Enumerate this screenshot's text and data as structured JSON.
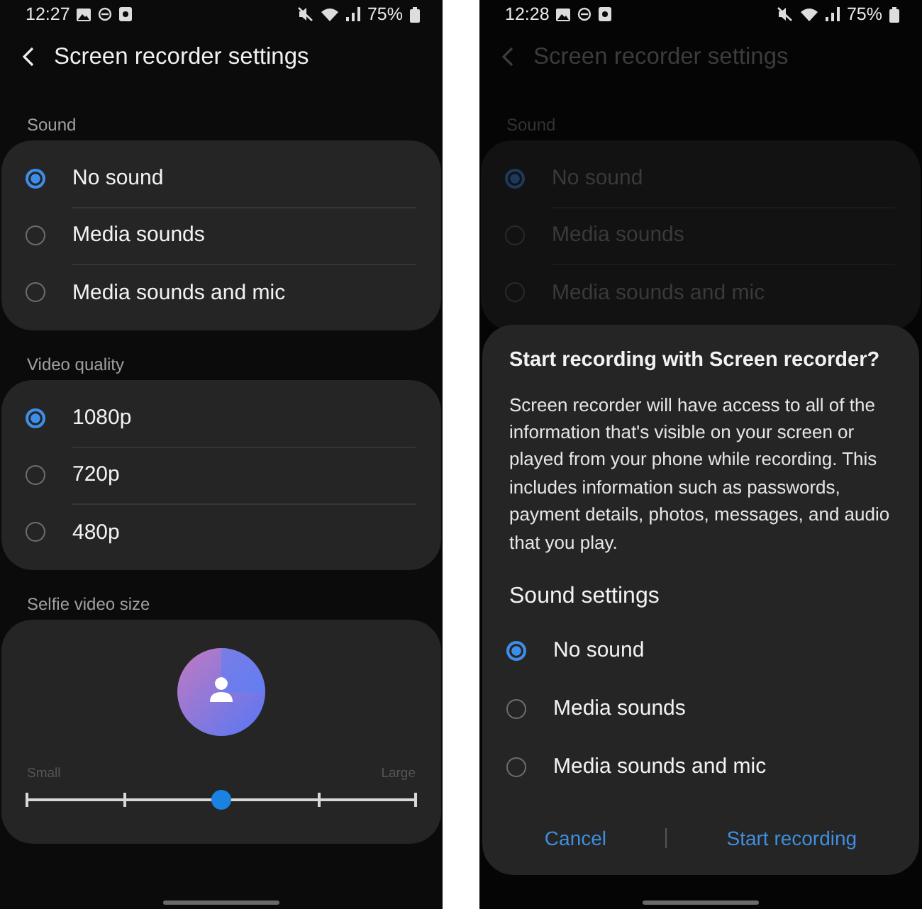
{
  "screens": [
    {
      "dimmed": false,
      "status_bar": {
        "time": "12:27",
        "battery": "75%"
      },
      "header": {
        "title": "Screen recorder settings"
      },
      "sections": [
        {
          "title": "Sound",
          "kind": "radio",
          "options": [
            {
              "label": "No sound",
              "selected": true
            },
            {
              "label": "Media sounds",
              "selected": false
            },
            {
              "label": "Media sounds and mic",
              "selected": false
            }
          ]
        },
        {
          "title": "Video quality",
          "kind": "radio",
          "options": [
            {
              "label": "1080p",
              "selected": true
            },
            {
              "label": "720p",
              "selected": false
            },
            {
              "label": "480p",
              "selected": false
            }
          ]
        },
        {
          "title": "Selfie video size",
          "kind": "slider",
          "min_label": "Small",
          "max_label": "Large",
          "level": 0.5
        }
      ]
    },
    {
      "dimmed": true,
      "status_bar": {
        "time": "12:28",
        "battery": "75%"
      },
      "header": {
        "title": "Screen recorder settings"
      },
      "sections": [
        {
          "title": "Sound",
          "kind": "radio",
          "options": [
            {
              "label": "No sound",
              "selected": true
            },
            {
              "label": "Media sounds",
              "selected": false
            },
            {
              "label": "Media sounds and mic",
              "selected": false
            }
          ]
        }
      ],
      "dialog": {
        "title": "Start recording with Screen recorder?",
        "body": "Screen recorder will have access to all of the information that's visible on your screen or played from your phone while recording. This includes information such as passwords, payment details, photos, messages, and audio that you play.",
        "subtitle": "Sound settings",
        "options": [
          {
            "label": "No sound",
            "selected": true
          },
          {
            "label": "Media sounds",
            "selected": false
          },
          {
            "label": "Media sounds and mic",
            "selected": false
          }
        ],
        "buttons": [
          "Cancel",
          "Start recording"
        ]
      }
    }
  ]
}
